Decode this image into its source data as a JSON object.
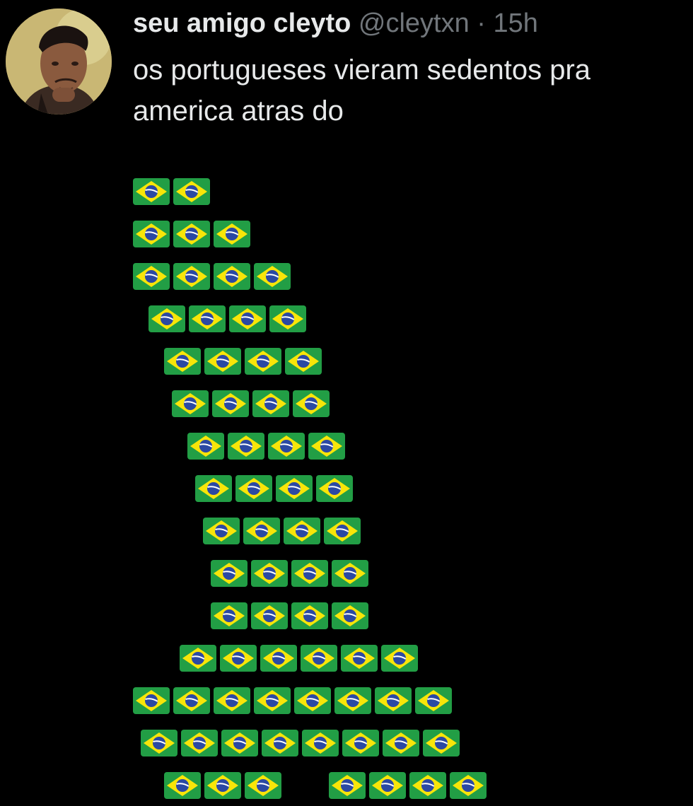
{
  "tweet": {
    "author": {
      "display_name": "seu amigo cleyto",
      "handle": "@cleytxn",
      "separator": "·",
      "time": "15h"
    },
    "text_line_1": "os portugueses vieram sedentos pra",
    "text_line_2": "america atras do",
    "flag_emoji": "brazil-flag-icon",
    "flag_counts_per_row": [
      2,
      3,
      4,
      4,
      4,
      4,
      4,
      4,
      4,
      4,
      4,
      6,
      8,
      8,
      7
    ]
  },
  "colors": {
    "background": "#000000",
    "text_primary": "#e7e9ea",
    "text_secondary": "#71767b",
    "flag_green": "#229e45",
    "flag_yellow": "#f8e509",
    "flag_blue": "#2b49a3"
  }
}
